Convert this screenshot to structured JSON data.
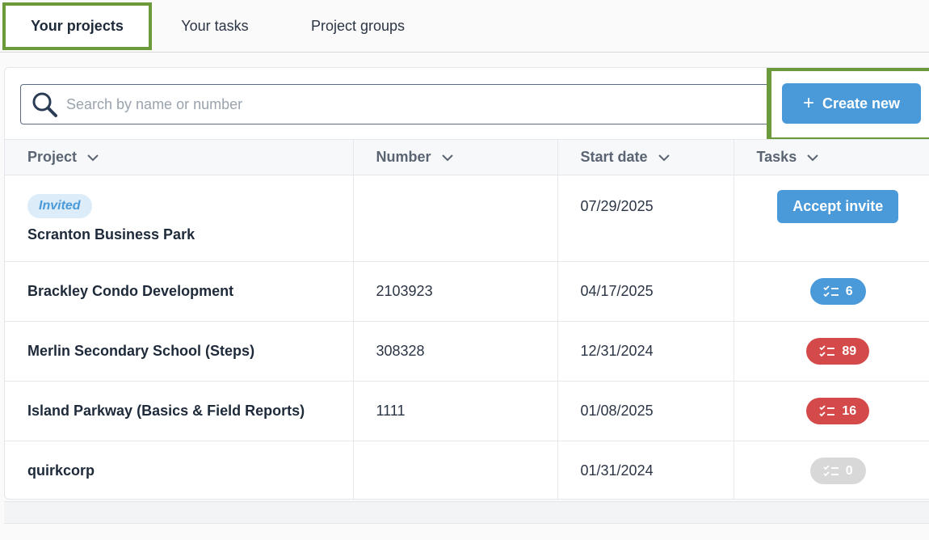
{
  "tabs": [
    {
      "label": "Your projects",
      "active": true
    },
    {
      "label": "Your tasks",
      "active": false
    },
    {
      "label": "Project groups",
      "active": false
    }
  ],
  "search": {
    "placeholder": "Search by name or number",
    "value": ""
  },
  "create_button": {
    "label": "Create new"
  },
  "table": {
    "headers": [
      "Project",
      "Number",
      "Start date",
      "Tasks"
    ],
    "rows": [
      {
        "badge": "Invited",
        "name": "Scranton Business Park",
        "number": "",
        "start_date": "07/29/2025",
        "action": "Accept invite"
      },
      {
        "name": "Brackley Condo Development",
        "number": "2103923",
        "start_date": "04/17/2025",
        "tasks": "6",
        "status": "blue"
      },
      {
        "name": "Merlin Secondary School (Steps)",
        "number": "308328",
        "start_date": "12/31/2024",
        "tasks": "89",
        "status": "red"
      },
      {
        "name": "Island Parkway (Basics & Field Reports)",
        "number": "1111",
        "start_date": "01/08/2025",
        "tasks": "16",
        "status": "red"
      },
      {
        "name": "quirkcorp",
        "number": "",
        "start_date": "01/31/2024",
        "tasks": "0",
        "status": "grey"
      }
    ]
  },
  "colors": {
    "accent": "#4a9ad9",
    "danger": "#d44a4a",
    "muted": "#d8d8d8",
    "highlight": "#6a9a3a"
  },
  "icons": {
    "search": "search-icon",
    "plus": "plus-icon",
    "sort": "chevron-down-icon",
    "tasks": "checklist-icon"
  }
}
